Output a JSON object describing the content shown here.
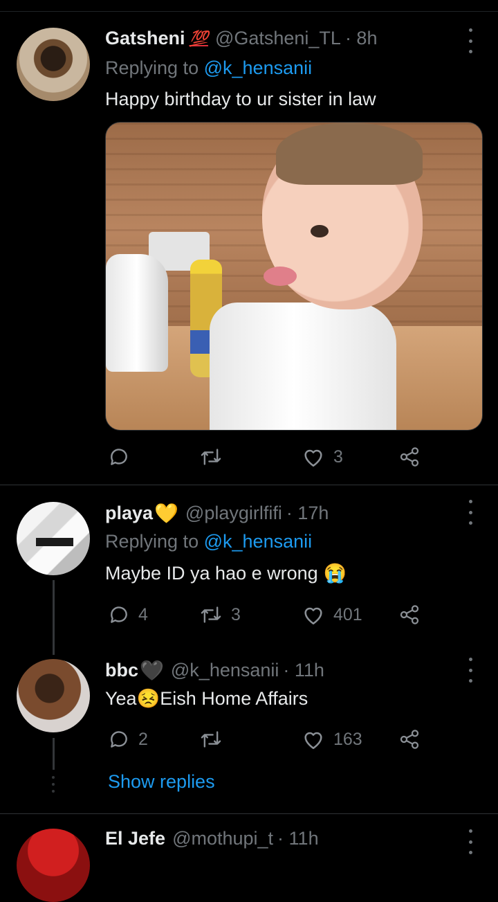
{
  "tweets": [
    {
      "name": "Gatsheni",
      "badge": "💯",
      "handle": "@Gatsheni_TL",
      "time": "· 8h",
      "replying_prefix": "Replying to",
      "replying_to": "@k_hensanii",
      "text": "Happy birthday to ur sister in law",
      "replies": "",
      "retweets": "",
      "likes": "3"
    },
    {
      "name": "playa",
      "badge": "💛",
      "handle": "@playgirlfifi",
      "time": "· 17h",
      "replying_prefix": "Replying to",
      "replying_to": "@k_hensanii",
      "text": "Maybe ID ya hao e wrong",
      "text_emoji": "😭",
      "replies": "4",
      "retweets": "3",
      "likes": "401"
    },
    {
      "name": "bbc",
      "badge": "🖤",
      "handle": "@k_hensanii",
      "time": "· 11h",
      "text_before": "Yea",
      "text_emoji": "😣",
      "text_after": "Eish Home Affairs",
      "replies": "2",
      "retweets": "",
      "likes": "163"
    },
    {
      "name": "El Jefe",
      "handle": "@mothupi_t",
      "time": "· 11h"
    }
  ],
  "show_replies": "Show replies",
  "colors": {
    "background": "#000000",
    "text": "#e7e9ea",
    "muted": "#71767b",
    "link": "#1d9bf0",
    "divider": "#2f3336"
  }
}
